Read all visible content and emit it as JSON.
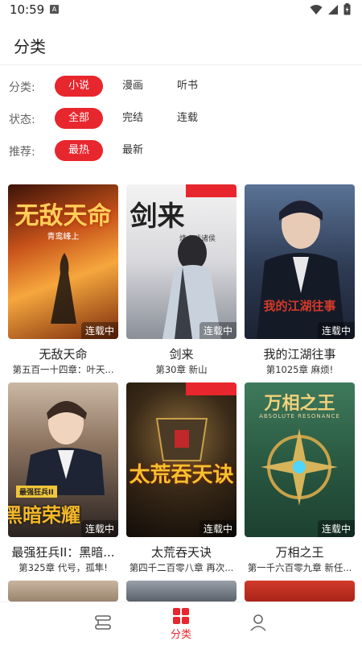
{
  "status_bar": {
    "time": "10:59",
    "notif_letter": "A"
  },
  "header": {
    "title": "分类"
  },
  "filters": {
    "category": {
      "label": "分类:",
      "options": [
        "小说",
        "漫画",
        "听书"
      ]
    },
    "status": {
      "label": "状态:",
      "options": [
        "全部",
        "完结",
        "连载"
      ]
    },
    "recommend": {
      "label": "推荐:",
      "options": [
        "最热",
        "最新"
      ]
    }
  },
  "books": [
    {
      "title": "无敌天命",
      "chapter": "第五百一十四章：叶天...",
      "badge": "连载中",
      "cover_text": "无敌天命",
      "cover_sub": "青鸾峰上"
    },
    {
      "title": "剑来",
      "chapter": "第30章 新山",
      "badge": "连载中",
      "cover_text": "剑来",
      "cover_sub": "烽火戏诸侯"
    },
    {
      "title": "我的江湖往事",
      "chapter": "第1025章 麻烦!",
      "badge": "连载中",
      "cover_text": "我的江湖往事",
      "cover_sub": ""
    },
    {
      "title": "最强狂兵II：黑暗...",
      "chapter": "第325章 代号，孤隼!",
      "badge": "连载中",
      "cover_text": "黑暗荣耀",
      "cover_sub": "最强狂兵II"
    },
    {
      "title": "太荒吞天诀",
      "chapter": "第四千二百零八章 再次...",
      "badge": "连载中",
      "cover_text": "太荒吞天诀",
      "cover_sub": ""
    },
    {
      "title": "万相之王",
      "chapter": "第一千六百零九章 新任...",
      "badge": "连载中",
      "cover_text": "万相之王",
      "cover_sub": "ABSOLUTE RESONANCE"
    }
  ],
  "bottom_nav": {
    "active_label": "分类"
  },
  "colors": {
    "accent": "#e8262d"
  }
}
